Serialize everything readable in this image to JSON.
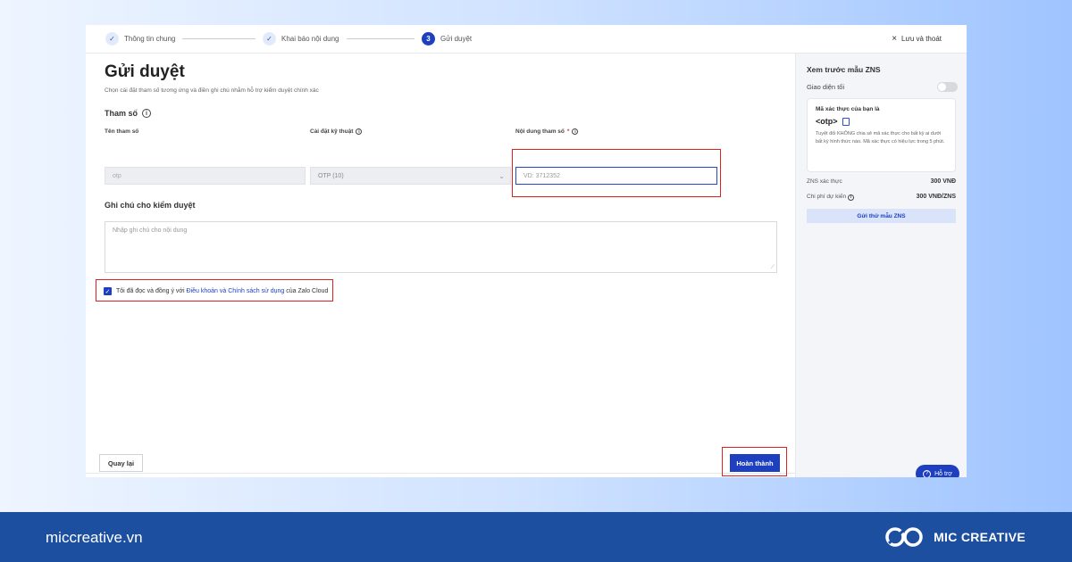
{
  "stepper": {
    "steps": [
      {
        "label": "Thông tin chung",
        "marker": "✓"
      },
      {
        "label": "Khai báo nội dung",
        "marker": "✓"
      },
      {
        "label": "Gửi duyệt",
        "marker": "3"
      }
    ],
    "save_exit": "Lưu và thoát"
  },
  "page": {
    "title": "Gửi duyệt",
    "subtitle": "Chọn cài đặt tham số tương ứng và điền ghi chú nhằm hỗ trợ kiểm duyệt chính xác"
  },
  "params": {
    "section_title": "Tham số",
    "col_name": "Tên tham số",
    "col_setting": "Cài đặt kỹ thuật",
    "col_content": "Nội dung tham số",
    "required_mark": "*",
    "name_value": "otp",
    "setting_value": "OTP (10)",
    "content_placeholder": "VD: 3712352"
  },
  "notes": {
    "section_title": "Ghi chú cho kiểm duyệt",
    "placeholder": "Nhập ghi chú cho nội dung"
  },
  "agreement": {
    "prefix": "Tôi đã đọc và đồng ý với",
    "link": "Điều khoản và Chính sách sử dụng",
    "suffix": "của Zalo Cloud",
    "checked": true
  },
  "footer": {
    "back_label": "Quay lại",
    "finish_label": "Hoàn thành"
  },
  "preview": {
    "title": "Xem trước mẫu ZNS",
    "dark_mode": "Giao diện tối",
    "card_heading": "Mã xác thực của bạn là",
    "card_otp": "<otp>",
    "card_body": "Tuyệt đối KHÔNG chia sẻ mã xác thực cho bất kỳ ai dưới bất kỳ hình thức nào. Mã xác thực có hiệu lực trong 5 phút.",
    "zns_label": "ZNS xác thực",
    "zns_value": "300 VNĐ",
    "cost_label": "Chi phí dự kiến",
    "cost_value": "300 VNĐ/ZNS",
    "send_test": "Gửi thử mẫu ZNS",
    "support": "Hỗ trợ"
  },
  "bottom_bar": {
    "site": "miccreative.vn",
    "brand": "MIC CREATIVE"
  },
  "colors": {
    "primary": "#1e3fbf",
    "highlight": "#d22222",
    "bar": "#1c4fa0"
  }
}
